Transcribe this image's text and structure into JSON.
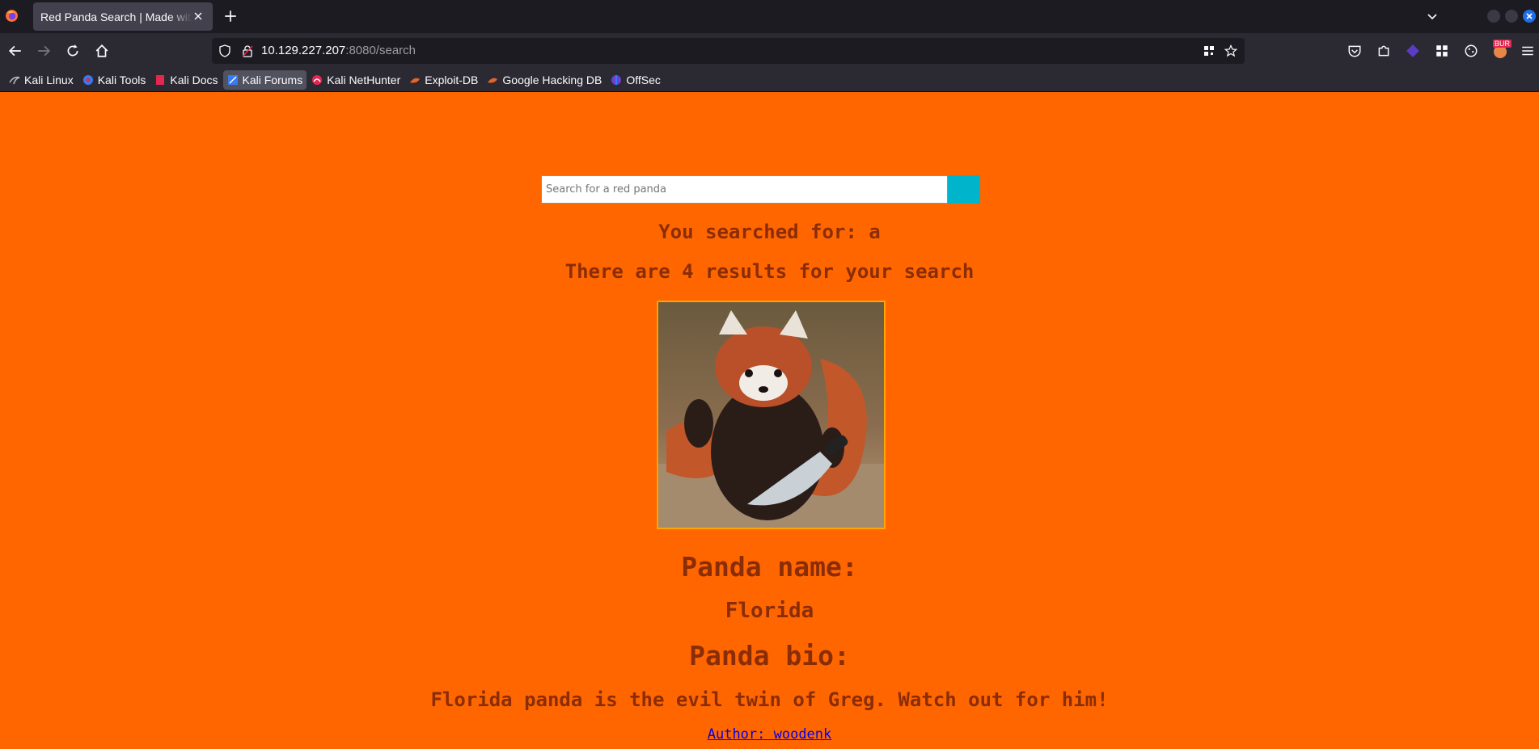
{
  "browser": {
    "tab_title": "Red Panda Search | Made with Spring Boot",
    "url_host": "10.129.227.207",
    "url_rest": ":8080/search",
    "bookmarks": [
      {
        "label": "Kali Linux",
        "icon": "kali-icon"
      },
      {
        "label": "Kali Tools",
        "icon": "kali-tools-icon"
      },
      {
        "label": "Kali Docs",
        "icon": "kali-docs-icon"
      },
      {
        "label": "Kali Forums",
        "icon": "kali-forums-icon"
      },
      {
        "label": "Kali NetHunter",
        "icon": "nethunter-icon"
      },
      {
        "label": "Exploit-DB",
        "icon": "exploit-db-icon"
      },
      {
        "label": "Google Hacking DB",
        "icon": "ghdb-icon"
      },
      {
        "label": "OffSec",
        "icon": "offsec-icon"
      }
    ],
    "extension_badge": "BUR"
  },
  "page": {
    "search_placeholder": "Search for a red panda",
    "searched_for": "You searched for: a",
    "results_text": "There are 4 results for your search",
    "panda_name_heading": "Panda name:",
    "panda_name": "Florida",
    "panda_bio_heading": "Panda bio:",
    "panda_bio": "Florida panda is the evil twin of Greg. Watch out for him!",
    "author_link": "Author: woodenk"
  },
  "colors": {
    "page_background": "#ff6600",
    "text": "#8a2d06",
    "search_button": "#00b4cc",
    "image_border": "#ffa500"
  }
}
